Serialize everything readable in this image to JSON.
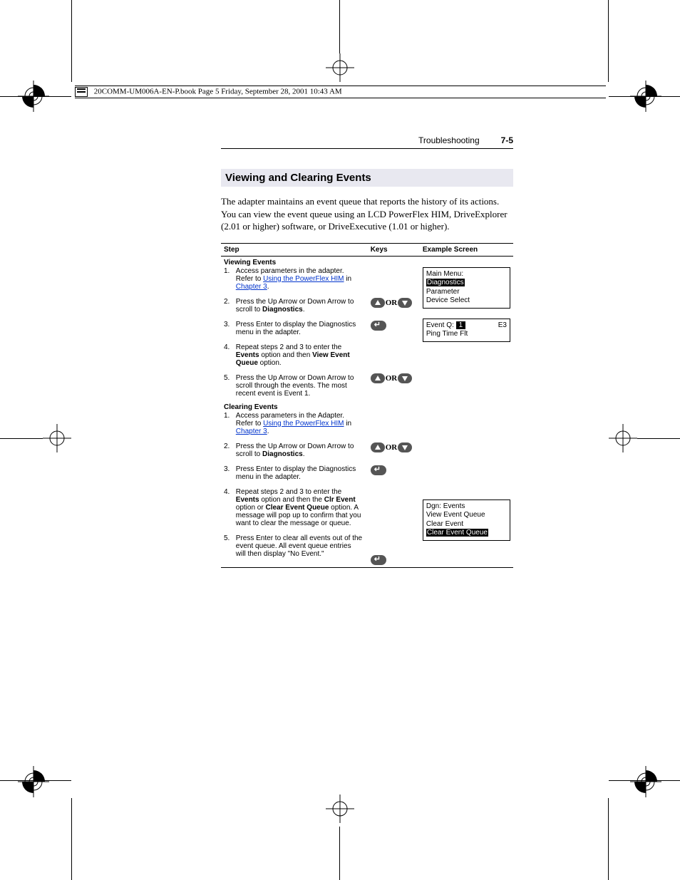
{
  "printHeader": "20COMM-UM006A-EN-P.book  Page 5  Friday, September 28, 2001  10:43 AM",
  "header": {
    "section": "Troubleshooting",
    "pageNum": "7-5"
  },
  "title": "Viewing and Clearing Events",
  "intro": "The adapter maintains an event queue that reports the history of its actions. You can view the event queue using an LCD PowerFlex HIM, DriveExplorer (2.01 or higher) software, or DriveExecutive (1.01 or higher).",
  "tableHeaders": {
    "step": "Step",
    "keys": "Keys",
    "screen": "Example Screen"
  },
  "viewing": {
    "heading": "Viewing Events",
    "s1a": "Access parameters in the adapter. Refer to ",
    "s1link": "Using the PowerFlex HIM",
    "s1b": " in ",
    "s1link2": "Chapter 3",
    "s1c": ".",
    "s2a": "Press the Up Arrow or Down Arrow to scroll to ",
    "s2b": "Diagnostics",
    "s2c": ".",
    "s3": "Press Enter to display the Diagnostics menu in the adapter.",
    "s4a": "Repeat steps 2 and 3 to enter the ",
    "s4b": "Events",
    "s4c": " option and then ",
    "s4d": "View Event Queue",
    "s4e": " option.",
    "s5": "Press the Up Arrow or Down Arrow to scroll through the events. The most recent event is Event 1."
  },
  "clearing": {
    "heading": "Clearing Events",
    "s1a": "Access parameters in the Adapter. Refer to ",
    "s1link": "Using the PowerFlex HIM",
    "s1b": " in ",
    "s1link2": "Chapter 3",
    "s1c": ".",
    "s2a": "Press the Up Arrow or Down Arrow to scroll to ",
    "s2b": "Diagnostics",
    "s2c": ".",
    "s3": "Press Enter to display the Diagnostics menu in the adapter.",
    "s4a": "Repeat steps 2 and 3 to enter the ",
    "s4b": "Events",
    "s4c": " option and then the ",
    "s4d": "Clr Event",
    "s4e": " option or ",
    "s4f": "Clear Event Queue",
    "s4g": " option. A message will pop up to confirm that you want to clear the message or queue.",
    "s5": "Press Enter to clear all events out of the event queue. All event queue entries will then display \"No Event.\""
  },
  "keys": {
    "or": "OR"
  },
  "lcd1": {
    "l1": "Main Menu:",
    "l2": "Diagnostics",
    "l3": "Parameter",
    "l4": "Device Select"
  },
  "lcd2": {
    "l1a": "Event Q:",
    "l1num": "1",
    "l1b": "E3",
    "l2": "Ping Time Flt"
  },
  "lcd3": {
    "l1": "Dgn: Events",
    "l2": "View Event Queue",
    "l3": "Clear Event",
    "l4": "Clear Event Queue"
  }
}
